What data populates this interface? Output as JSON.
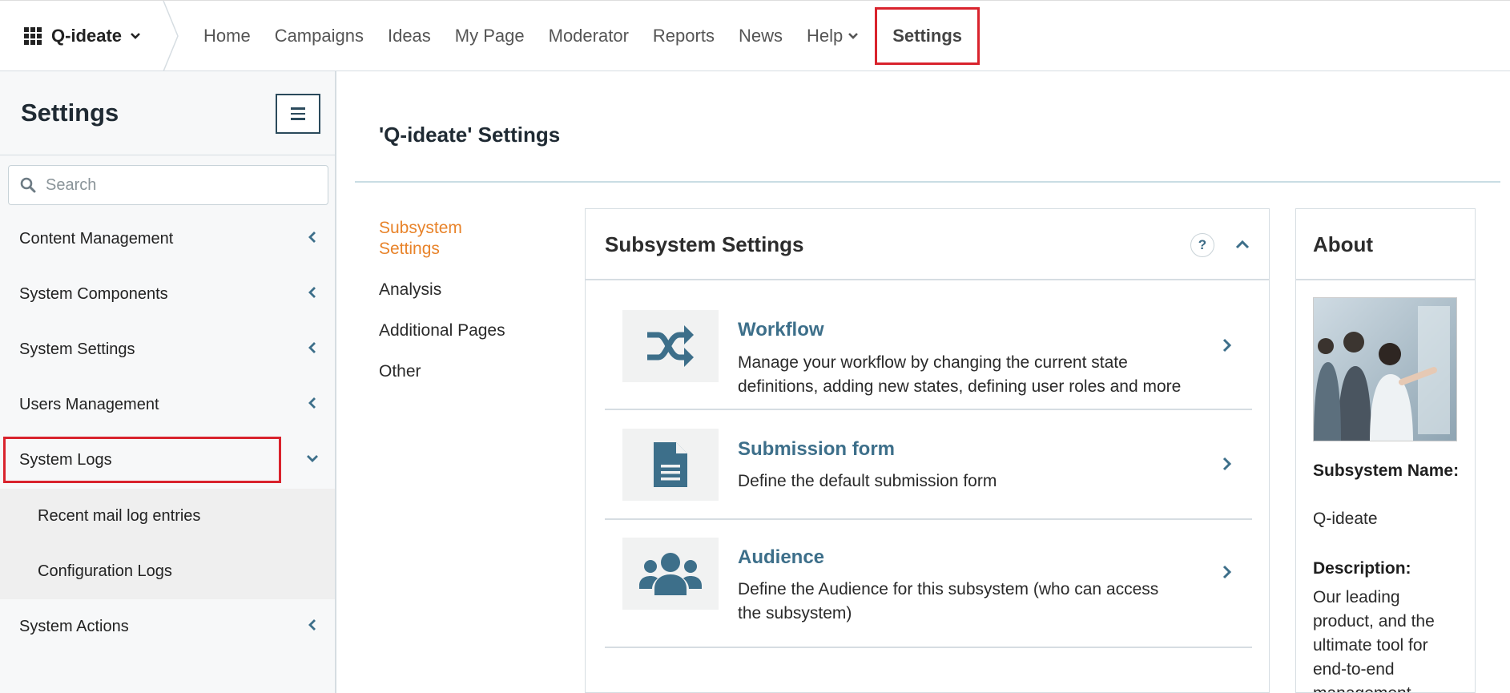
{
  "topbar": {
    "brand": "Q-ideate",
    "nav": [
      {
        "label": "Home"
      },
      {
        "label": "Campaigns"
      },
      {
        "label": "Ideas"
      },
      {
        "label": "My Page"
      },
      {
        "label": "Moderator"
      },
      {
        "label": "Reports"
      },
      {
        "label": "News"
      },
      {
        "label": "Help"
      },
      {
        "label": "Settings",
        "active": true
      }
    ]
  },
  "sidebar": {
    "title": "Settings",
    "search_placeholder": "Search",
    "items": [
      {
        "label": "Content Management"
      },
      {
        "label": "System Components"
      },
      {
        "label": "System Settings"
      },
      {
        "label": "Users Management"
      },
      {
        "label": "System Logs",
        "expanded": true
      },
      {
        "label": "System Actions"
      }
    ],
    "sub_items": [
      {
        "label": "Recent mail log entries"
      },
      {
        "label": "Configuration Logs"
      }
    ]
  },
  "main": {
    "title": "'Q-ideate' Settings",
    "subnav": [
      {
        "label": "Subsystem Settings",
        "active": true
      },
      {
        "label": "Analysis"
      },
      {
        "label": "Additional Pages"
      },
      {
        "label": "Other"
      }
    ],
    "card": {
      "title": "Subsystem Settings",
      "help": "?",
      "rows": [
        {
          "title": "Workflow",
          "description": "Manage your workflow by changing the current state definitions, adding new states, defining user roles and more",
          "icon": "shuffle-icon"
        },
        {
          "title": "Submission form",
          "description": "Define the default submission form",
          "icon": "document-icon"
        },
        {
          "title": "Audience",
          "description": "Define the Audience for this subsystem (who can access the subsystem)",
          "icon": "users-icon"
        }
      ]
    },
    "about": {
      "title": "About",
      "name_label": "Subsystem Name:",
      "name_value": "Q-ideate",
      "desc_label": "Description:",
      "desc_value": "Our leading product, and the ultimate tool for end-to-end management"
    }
  },
  "colors": {
    "accent_red": "#d9232d",
    "link_blue": "#3d6f8a",
    "active_orange": "#e8832a"
  }
}
